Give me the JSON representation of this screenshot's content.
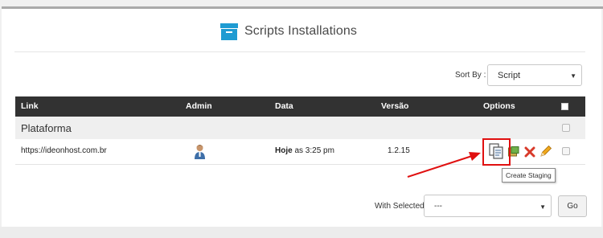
{
  "title": "Scripts Installations",
  "sort": {
    "label": "Sort By :",
    "value": "Script"
  },
  "table": {
    "headers": [
      "Link",
      "Admin",
      "Data",
      "Versão",
      "Options"
    ],
    "group": "Plataforma",
    "rows": [
      {
        "link": "https://ideonhost.com.br",
        "date_day": "Hoje",
        "date_rest": " as 3:25 pm",
        "version": "1.2.15"
      }
    ]
  },
  "tooltip": "Create Staging",
  "bulk": {
    "label": "With Selected:",
    "value": "---",
    "go": "Go"
  },
  "colors": {
    "header_bg": "#323232",
    "highlight": "#e01010",
    "title_icon": "#1e9bd2"
  },
  "icons": [
    "archive-box-icon",
    "user-icon",
    "staging-icon",
    "clone-icon",
    "delete-icon",
    "edit-icon",
    "checkbox-icon"
  ]
}
